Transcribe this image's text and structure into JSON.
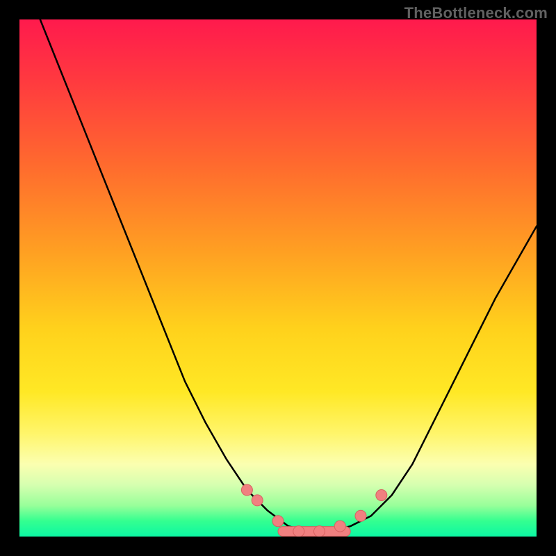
{
  "watermark": "TheBottleneck.com",
  "colors": {
    "gradient_top": "#ff1a4d",
    "gradient_mid1": "#ffa022",
    "gradient_mid2": "#ffe825",
    "gradient_bottom": "#0cf7a3",
    "curve_stroke": "#000000",
    "marker_fill": "#f08080",
    "marker_stroke": "#d86060",
    "frame": "#000000"
  },
  "chart_data": {
    "type": "line",
    "title": "",
    "xlabel": "",
    "ylabel": "",
    "xlim": [
      0,
      100
    ],
    "ylim": [
      0,
      100
    ],
    "series": [
      {
        "name": "bottleneck-curve",
        "x": [
          4,
          8,
          12,
          16,
          20,
          24,
          28,
          32,
          36,
          40,
          44,
          48,
          52,
          56,
          60,
          64,
          68,
          72,
          76,
          80,
          84,
          88,
          92,
          96,
          100
        ],
        "y": [
          100,
          90,
          80,
          70,
          60,
          50,
          40,
          30,
          22,
          15,
          9,
          5,
          2,
          1,
          1,
          2,
          4,
          8,
          14,
          22,
          30,
          38,
          46,
          53,
          60
        ]
      }
    ],
    "markers": {
      "name": "highlighted-points",
      "x": [
        44,
        46,
        50,
        54,
        58,
        62,
        66,
        70
      ],
      "y": [
        9,
        7,
        3,
        1,
        1,
        2,
        4,
        8
      ]
    },
    "trough_segment": {
      "x_start": 50,
      "x_end": 64,
      "y": 1
    }
  }
}
